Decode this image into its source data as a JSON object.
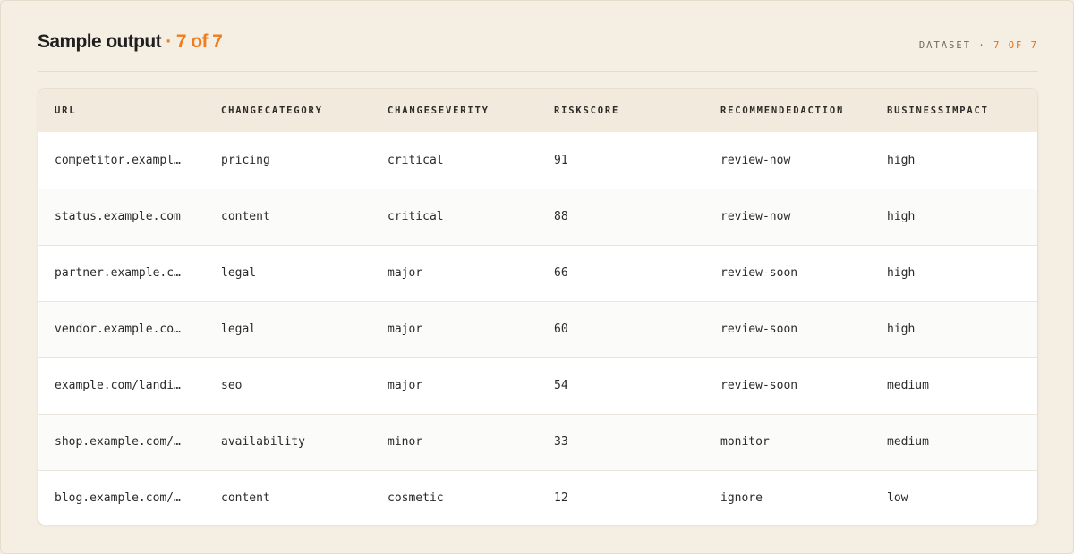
{
  "header": {
    "title": "Sample output",
    "title_accent": "· 7 of 7",
    "dataset_label": "DATASET ·",
    "dataset_count": "7 OF 7"
  },
  "colors": {
    "accent": "#f07c1e",
    "background": "#f5efe3",
    "table_header": "#f2eadd"
  },
  "table": {
    "columns": [
      "URL",
      "CHANGECATEGORY",
      "CHANGESEVERITY",
      "RISKSCORE",
      "RECOMMENDEDACTION",
      "BUSINESSIMPACT"
    ],
    "rows": [
      [
        "competitor.exampl…",
        "pricing",
        "critical",
        "91",
        "review-now",
        "high"
      ],
      [
        "status.example.com",
        "content",
        "critical",
        "88",
        "review-now",
        "high"
      ],
      [
        "partner.example.c…",
        "legal",
        "major",
        "66",
        "review-soon",
        "high"
      ],
      [
        "vendor.example.co…",
        "legal",
        "major",
        "60",
        "review-soon",
        "high"
      ],
      [
        "example.com/landi…",
        "seo",
        "major",
        "54",
        "review-soon",
        "medium"
      ],
      [
        "shop.example.com/…",
        "availability",
        "minor",
        "33",
        "monitor",
        "medium"
      ],
      [
        "blog.example.com/…",
        "content",
        "cosmetic",
        "12",
        "ignore",
        "low"
      ]
    ]
  }
}
